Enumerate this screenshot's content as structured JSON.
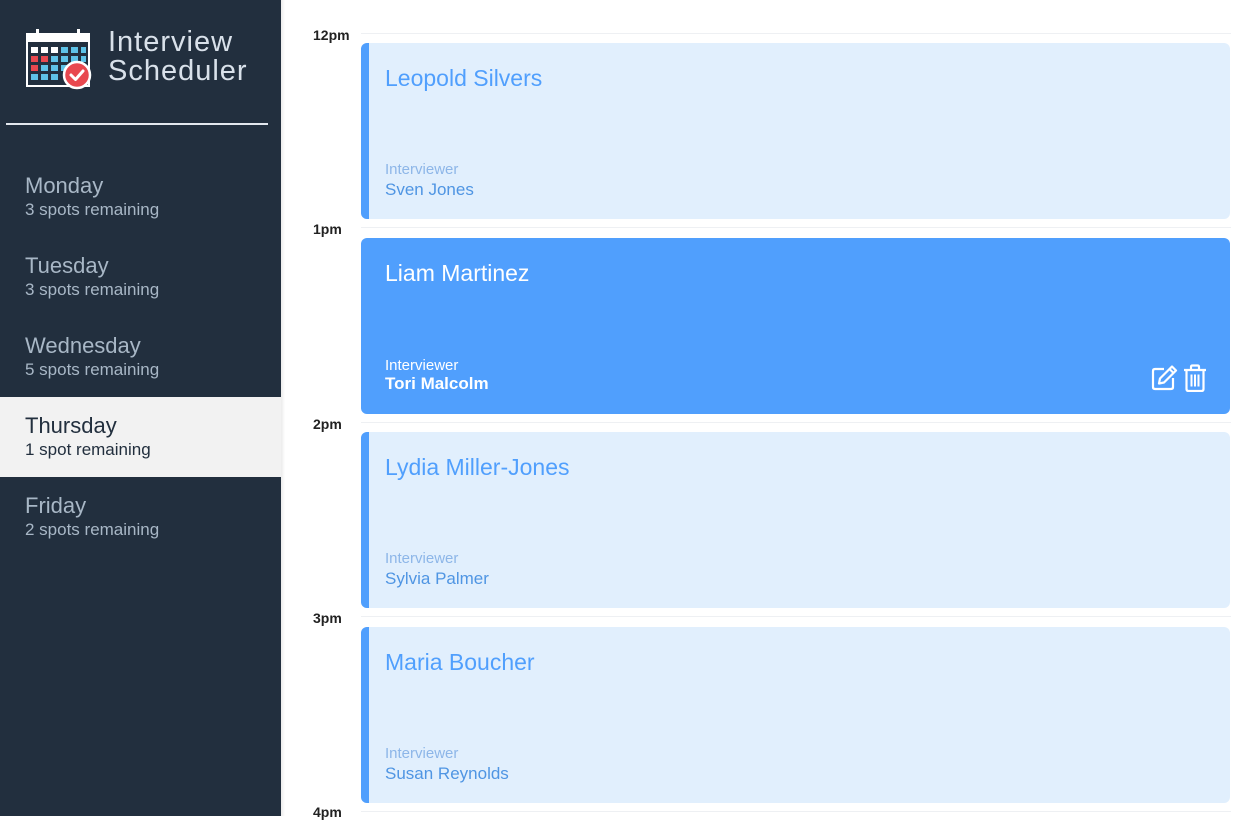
{
  "brand": {
    "line1": "Interview",
    "line2": "Scheduler",
    "logo_icon": "calendar-check-logo"
  },
  "days": [
    {
      "name": "Monday",
      "spots": "3 spots remaining",
      "selected": false
    },
    {
      "name": "Tuesday",
      "spots": "3 spots remaining",
      "selected": false
    },
    {
      "name": "Wednesday",
      "spots": "5 spots remaining",
      "selected": false
    },
    {
      "name": "Thursday",
      "spots": "1 spot remaining",
      "selected": true
    },
    {
      "name": "Friday",
      "spots": "2 spots remaining",
      "selected": false
    }
  ],
  "times": [
    "12pm",
    "1pm",
    "2pm",
    "3pm",
    "4pm"
  ],
  "appointments": [
    {
      "student": "Leopold Silvers",
      "interviewer_label": "Interviewer",
      "interviewer": "Sven Jones"
    },
    {
      "student": "Liam Martinez",
      "interviewer_label": "Interviewer",
      "interviewer": "Tori Malcolm",
      "active": true,
      "actions": [
        "edit-icon",
        "trash-icon"
      ]
    },
    {
      "student": "Lydia Miller-Jones",
      "interviewer_label": "Interviewer",
      "interviewer": "Sylvia Palmer"
    },
    {
      "student": "Maria Boucher",
      "interviewer_label": "Interviewer",
      "interviewer": "Susan Reynolds"
    }
  ],
  "colors": {
    "sidebar": "#222f3e",
    "accent": "#509ffd",
    "appointment_bg": "#e1effd",
    "selected_day_bg": "#f2f2f2"
  }
}
